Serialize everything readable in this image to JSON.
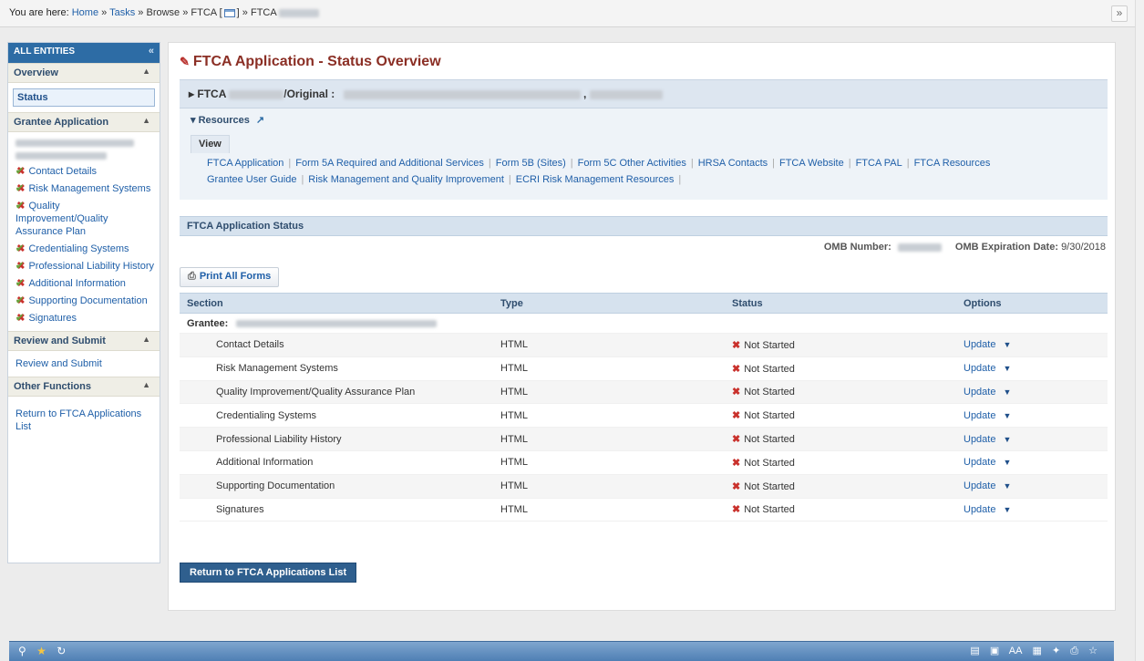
{
  "breadcrumb": {
    "lead": "You are here:",
    "home": "Home",
    "tasks": "Tasks",
    "browse": "Browse",
    "ftca1": "FTCA [",
    "ftca1_close": "]",
    "ftca2": "FTCA",
    "sep": "»"
  },
  "leftnav": {
    "header": "ALL ENTITIES",
    "overview": "Overview",
    "status": "Status",
    "grantee_app": "Grantee Application",
    "items": [
      {
        "label": "Contact Details"
      },
      {
        "label": "Risk Management Systems"
      },
      {
        "label": "Quality Improvement/Quality Assurance Plan"
      },
      {
        "label": "Credentialing Systems"
      },
      {
        "label": "Professional Liability History"
      },
      {
        "label": "Additional Information"
      },
      {
        "label": "Supporting Documentation"
      },
      {
        "label": "Signatures"
      }
    ],
    "review_group": "Review and Submit",
    "review_link": "Review and Submit",
    "other_group": "Other Functions",
    "return_link": "Return to FTCA Applications List"
  },
  "main": {
    "title": "FTCA Application - Status Overview",
    "app_bar_prefix": "FTCA",
    "app_bar_original": "/Original :",
    "app_bar_comma": ",",
    "resources_label": "Resources",
    "view_tab": "View",
    "resource_links": [
      "FTCA Application",
      "Form 5A Required and Additional Services",
      "Form 5B (Sites)",
      "Form 5C Other Activities",
      "HRSA Contacts",
      "FTCA Website",
      "FTCA PAL",
      "FTCA Resources",
      "Grantee User Guide",
      "Risk Management and Quality Improvement",
      "ECRI Risk Management Resources"
    ],
    "status_header": "FTCA Application Status",
    "omb_number_label": "OMB Number:",
    "omb_expiration_label": "OMB Expiration Date:",
    "omb_expiration_value": "9/30/2018",
    "print_all": "Print All Forms",
    "columns": {
      "section": "Section",
      "type": "Type",
      "status": "Status",
      "options": "Options"
    },
    "grantee_label": "Grantee:",
    "rows": [
      {
        "section": "Contact Details",
        "type": "HTML",
        "status": "Not Started",
        "option": "Update"
      },
      {
        "section": "Risk Management Systems",
        "type": "HTML",
        "status": "Not Started",
        "option": "Update"
      },
      {
        "section": "Quality Improvement/Quality Assurance Plan",
        "type": "HTML",
        "status": "Not Started",
        "option": "Update"
      },
      {
        "section": "Credentialing Systems",
        "type": "HTML",
        "status": "Not Started",
        "option": "Update"
      },
      {
        "section": "Professional Liability History",
        "type": "HTML",
        "status": "Not Started",
        "option": "Update"
      },
      {
        "section": "Additional Information",
        "type": "HTML",
        "status": "Not Started",
        "option": "Update"
      },
      {
        "section": "Supporting Documentation",
        "type": "HTML",
        "status": "Not Started",
        "option": "Update"
      },
      {
        "section": "Signatures",
        "type": "HTML",
        "status": "Not Started",
        "option": "Update"
      }
    ],
    "return_button": "Return to FTCA Applications List"
  },
  "bottombar": {
    "zoom_label": "AA"
  },
  "icons": {
    "status_icon": "not-started-icon",
    "print": "printer-icon",
    "external": "external-link-icon"
  },
  "colors": {
    "brand_blue": "#2d6ca5",
    "title_red": "#8b2f25",
    "link_blue": "#1f5fa8"
  }
}
